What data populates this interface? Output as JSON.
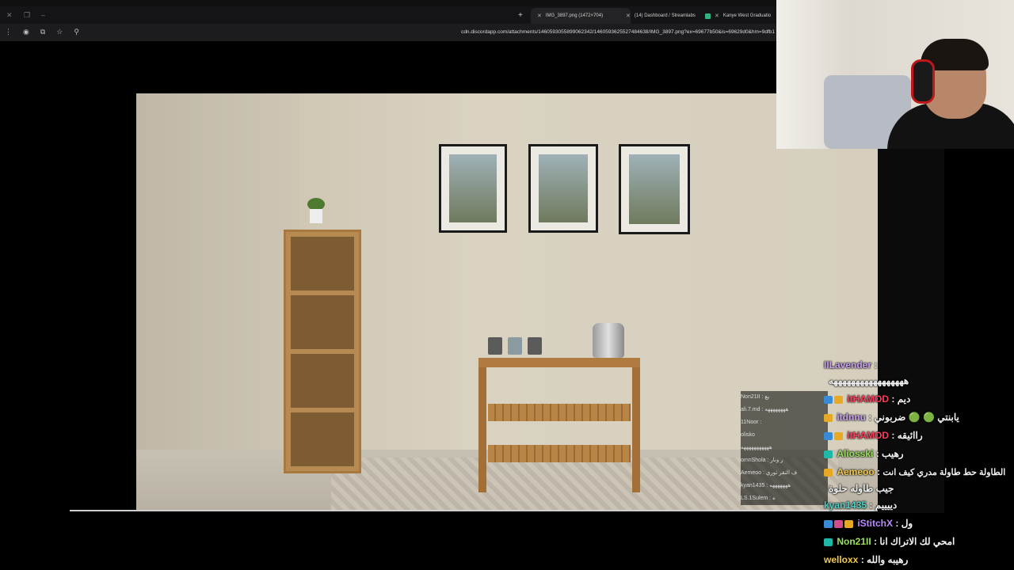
{
  "browser": {
    "tabs": [
      {
        "label": "IMG_3897.png (1472×704)",
        "active": true
      },
      {
        "label": "(14) Dashboard / Streamlabs",
        "active": false
      },
      {
        "label": "Kanye West Graduatio",
        "active": false
      }
    ],
    "url": "cdn.discordapp.com/attachments/1460593055899062342/1460593625527484638/IMG_3897.png?ex=69677b50&is=69629d0&hm=9dfb1"
  },
  "minichat": {
    "lines": [
      "Non21II : يع",
      "ali.7.md : ههههههههه",
      "11Noor :",
      "olisko",
      "هههههههههههه",
      "omnShola : ر ونار",
      "Aemeoo : ف التقر ثوري",
      "kyan1435 : هههههههه",
      "LS.1Sulem : ه"
    ]
  },
  "chat": {
    "messages": [
      {
        "user": "IILavender",
        "color": "#c9a0f0",
        "text": "هههههههههههههههههه"
      },
      {
        "user": "itHAMOD",
        "color": "#ff3b5c",
        "text": "ديم",
        "badges": [
          "blue",
          "gold"
        ]
      },
      {
        "user": "itdnnu",
        "color": "#c9a0f0",
        "text": "يابنتي 🟢 🟢 ضربوني",
        "badges": [
          "gold"
        ]
      },
      {
        "user": "itHAMOD",
        "color": "#ff3b5c",
        "text": "راائيقه",
        "badges": [
          "blue",
          "gold"
        ]
      },
      {
        "user": "Aliosski",
        "color": "#9be15d",
        "text": "رهيب",
        "badges": [
          "teal"
        ]
      },
      {
        "user": "Aemeoo",
        "color": "#f2c94c",
        "text": "الطاولة حط طاولة مدري كيف انت",
        "text2": "جيب طاوله حلوة",
        "badges": [
          "gold"
        ]
      },
      {
        "user": "kyan1435",
        "color": "#4fd1c5",
        "text": "دييييم"
      },
      {
        "user": "iStitchX",
        "color": "#b98cff",
        "text": "ول",
        "badges": [
          "blue",
          "pink",
          "gold"
        ]
      },
      {
        "user": "Non21II",
        "color": "#9be15d",
        "text": "امحي لك الاتراك انا",
        "badges": [
          "teal"
        ]
      },
      {
        "user": "welloxx",
        "color": "#f2c94c",
        "text": "رهيبه والله"
      }
    ]
  }
}
